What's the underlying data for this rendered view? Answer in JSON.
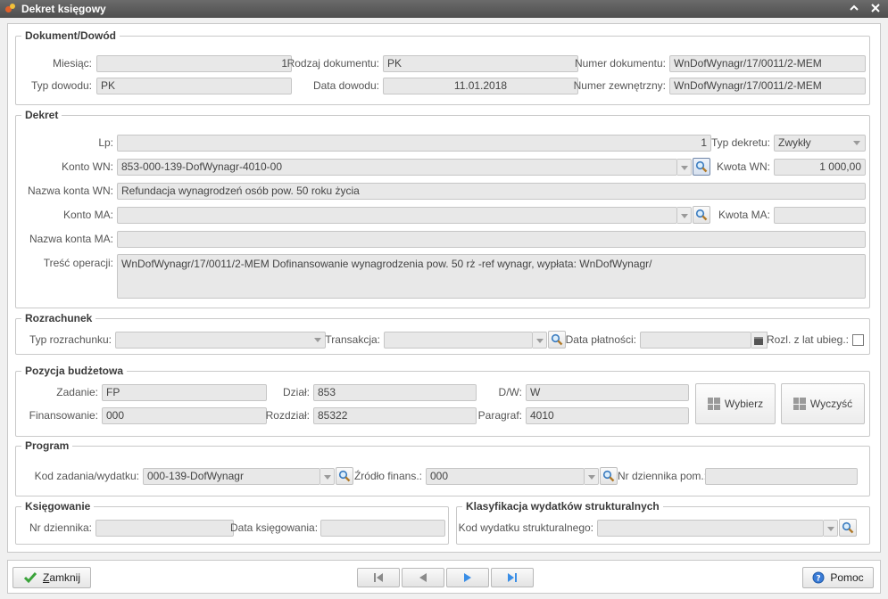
{
  "window": {
    "title": "Dekret księgowy"
  },
  "dokument": {
    "legend": "Dokument/Dowód",
    "miesiac_label": "Miesiąc:",
    "miesiac_value": "1",
    "rodzaj_label": "Rodzaj dokumentu:",
    "rodzaj_value": "PK",
    "numer_label": "Numer dokumentu:",
    "numer_value": "WnDofWynagr/17/0011/2-MEM",
    "typ_dowodu_label": "Typ dowodu:",
    "typ_dowodu_value": "PK",
    "data_dowodu_label": "Data dowodu:",
    "data_dowodu_value": "11.01.2018",
    "numer_zewn_label": "Numer zewnętrzny:",
    "numer_zewn_value": "WnDofWynagr/17/0011/2-MEM"
  },
  "dekret": {
    "legend": "Dekret",
    "lp_label": "Lp:",
    "lp_value": "1",
    "typ_label": "Typ dekretu:",
    "typ_value": "Zwykły",
    "konto_wn_label": "Konto WN:",
    "konto_wn_value": "853-000-139-DofWynagr-4010-00",
    "kwota_wn_label": "Kwota WN:",
    "kwota_wn_value": "1 000,00",
    "nazwa_wn_label": "Nazwa konta WN:",
    "nazwa_wn_value": "Refundacja wynagrodzeń osób pow. 50 roku życia",
    "konto_ma_label": "Konto MA:",
    "konto_ma_value": "",
    "kwota_ma_label": "Kwota MA:",
    "kwota_ma_value": "",
    "nazwa_ma_label": "Nazwa konta MA:",
    "nazwa_ma_value": "",
    "tresc_label": "Treść operacji:",
    "tresc_value": "WnDofWynagr/17/0011/2-MEM Dofinansowanie wynagrodzenia pow. 50 rż -ref wynagr, wypłata: WnDofWynagr/"
  },
  "rozrachunek": {
    "legend": "Rozrachunek",
    "typ_label": "Typ rozrachunku:",
    "typ_value": "",
    "transakcja_label": "Transakcja:",
    "transakcja_value": "",
    "data_platnosci_label": "Data płatności:",
    "data_platnosci_value": "",
    "rozl_label": "Rozl. z lat ubieg.:"
  },
  "pozycja": {
    "legend": "Pozycja budżetowa",
    "zadanie_label": "Zadanie:",
    "zadanie_value": "FP",
    "dzial_label": "Dział:",
    "dzial_value": "853",
    "dw_label": "D/W:",
    "dw_value": "W",
    "finansowanie_label": "Finansowanie:",
    "finansowanie_value": "000",
    "rozdzial_label": "Rozdział:",
    "rozdzial_value": "85322",
    "paragraf_label": "Paragraf:",
    "paragraf_value": "4010",
    "wybierz_label": "Wybierz",
    "wyczysc_label": "Wyczyść"
  },
  "program": {
    "legend": "Program",
    "kod_label": "Kod zadania/wydatku:",
    "kod_value": "000-139-DofWynagr",
    "zrodlo_label": "Źródło finans.:",
    "zrodlo_value": "000",
    "nr_dziennika_label": "Nr dziennika pom.:",
    "nr_dziennika_value": ""
  },
  "ksiegowanie": {
    "legend": "Księgowanie",
    "nr_dziennika_label": "Nr dziennika:",
    "nr_dziennika_value": "",
    "data_label": "Data księgowania:",
    "data_value": ""
  },
  "klasyfikacja": {
    "legend": "Klasyfikacja wydatków strukturalnych",
    "kod_label": "Kod wydatku strukturalnego:",
    "kod_value": ""
  },
  "footer": {
    "zamknij_label": "Zamknij",
    "pomoc_label": "Pomoc"
  },
  "icons": {
    "search": "search-icon",
    "first": "first-record-icon",
    "prev": "previous-record-icon",
    "next": "next-record-icon",
    "last": "last-record-icon",
    "close": "checkmark-icon",
    "help": "help-icon"
  },
  "colors": {
    "titlebar": "#555555",
    "field_bg": "#e8e8e8",
    "accent": "#3a8ee6",
    "ok": "#3aa33a"
  }
}
